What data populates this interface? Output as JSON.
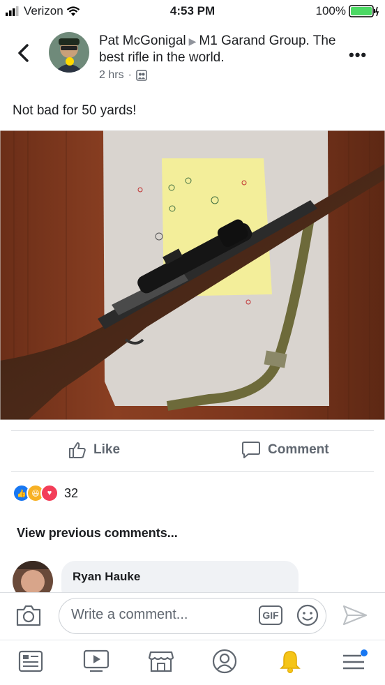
{
  "status_bar": {
    "carrier": "Verizon",
    "time": "4:53 PM",
    "battery": "100%"
  },
  "post": {
    "author": "Pat McGonigal",
    "group": "M1 Garand Group. The best rifle in the world.",
    "time_ago": "2 hrs",
    "separator": "·",
    "text": "Not bad for 50 yards!"
  },
  "actions": {
    "like_label": "Like",
    "comment_label": "Comment"
  },
  "reactions": {
    "count": "32",
    "types": [
      "like",
      "haha",
      "love"
    ]
  },
  "comments": {
    "view_previous_label": "View previous comments...",
    "items": [
      {
        "author": "Ryan Hauke"
      }
    ]
  },
  "composer": {
    "placeholder": "Write a comment...",
    "gif_label": "GIF"
  },
  "colors": {
    "accent": "#1877f2",
    "muted": "#606770",
    "haha": "#f7b125",
    "love": "#f33e58"
  },
  "tabs": [
    "news-feed",
    "watch",
    "marketplace",
    "profile",
    "notifications",
    "menu"
  ]
}
